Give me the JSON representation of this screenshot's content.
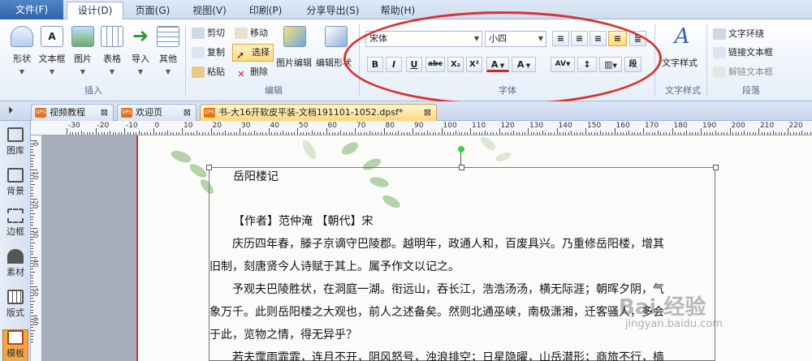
{
  "menu": {
    "file": "文件(F)",
    "design": "设计(D)",
    "page": "页面(G)",
    "view": "视图(V)",
    "print": "印刷(P)",
    "share": "分享导出(S)",
    "help": "帮助(H)"
  },
  "ribbon": {
    "insert": {
      "shape": "形状",
      "textbox": "文本框",
      "picture": "图片",
      "table": "表格",
      "import": "导入",
      "other": "其他",
      "group_label": "插入"
    },
    "edit": {
      "cut": "剪切",
      "move": "移动",
      "copy": "复制",
      "select": "选择",
      "paste": "粘贴",
      "delete": "删除",
      "picture_edit": "图片编辑",
      "edit_shape": "编辑形状",
      "group_label": "编辑"
    },
    "font": {
      "font_name": "宋体",
      "font_size": "小四",
      "bold": "B",
      "italic": "I",
      "underline": "U",
      "strike": "abc",
      "subscript": "X₂",
      "superscript": "X²",
      "font_color": "A",
      "char_style": "A",
      "char_spacing": "AV",
      "para": "段",
      "group_label": "字体"
    },
    "text_style": {
      "label": "文字样式",
      "group_label": "文字样式"
    },
    "paragraph": {
      "text_wrap": "文字环绕",
      "link_textbox": "链接文本框",
      "unlink_textbox": "解链文本框",
      "group_label": "段落"
    }
  },
  "tabs": [
    {
      "label": "视频教程"
    },
    {
      "label": "欢迎页"
    },
    {
      "label": "书-大16开软皮平装-文档191101-1052.dpsf*"
    }
  ],
  "left_panel": [
    "图库",
    "背景",
    "边框",
    "素材",
    "版式",
    "模板"
  ],
  "ruler_labels": [
    "-30",
    "-20",
    "-10",
    "0",
    "10",
    "20",
    "30",
    "40",
    "50",
    "60",
    "70",
    "80",
    "90",
    "100",
    "110",
    "120",
    "130",
    "140",
    "150",
    "160",
    "170",
    "180",
    "190",
    "200",
    "210",
    "220",
    "230"
  ],
  "vruler_labels": [
    "0",
    "10",
    "20",
    "30",
    "40",
    "50",
    "60"
  ],
  "document": {
    "title": "岳阳楼记",
    "author": "【作者】范仲淹 【朝代】宋",
    "lines": [
      "　　庆历四年春，滕子京谪守巴陵郡。越明年，政通人和，百废具兴。乃重修岳阳楼，增其",
      "旧制，刻唐贤今人诗赋于其上。属予作文以记之。",
      "　　予观夫巴陵胜状，在洞庭一湖。衔远山，吞长江，浩浩汤汤，横无际涯；朝晖夕阴，气",
      "象万千。此则岳阳楼之大观也，前人之述备矣。然则北通巫峡，南极潇湘，迁客骚人，多会",
      "于此，览物之情，得无异乎？",
      "　　若夫霪雨霏霏，连月不开，阴风怒号，浊浪排空；日星隐曜，山岳潜形；商旅不行，樯"
    ]
  },
  "watermark": {
    "main": "Bai 经验",
    "url": "jingyan.baidu.com"
  },
  "colors": {
    "annotation_ellipse": "#d8322f",
    "active_tab": "#ffd77a",
    "workspace": "#a9aebd"
  }
}
